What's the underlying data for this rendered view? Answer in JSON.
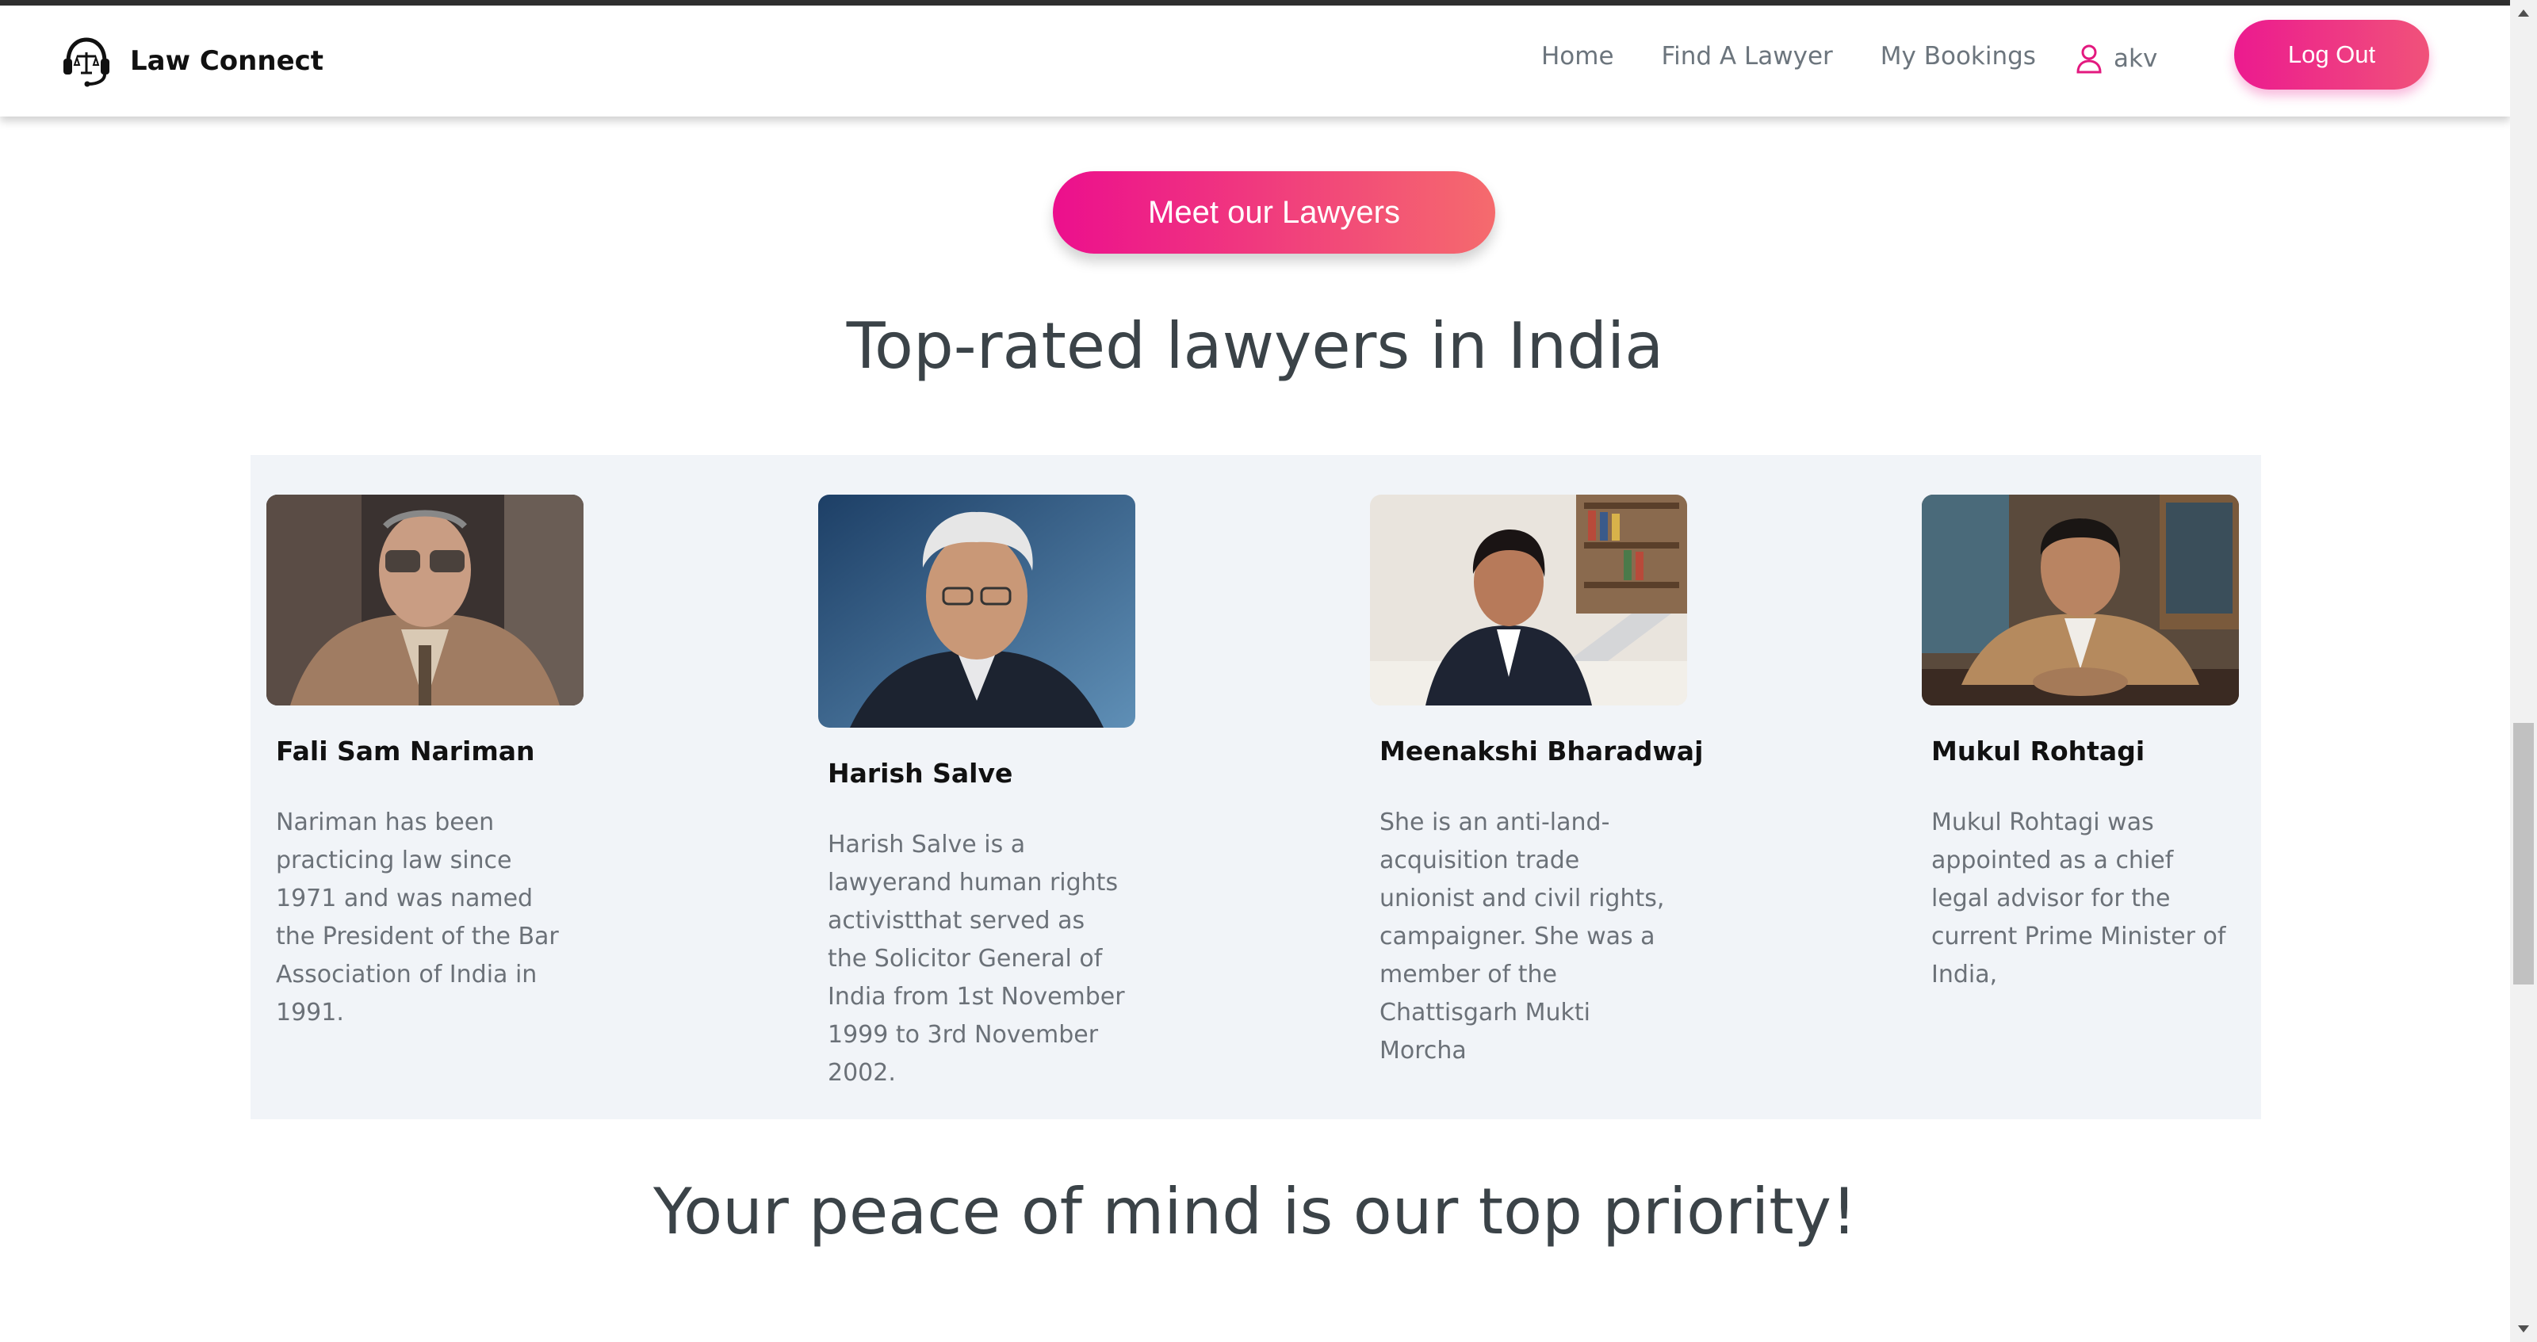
{
  "nav": {
    "brand": "Law Connect",
    "brand_icon": "support-headset-scales-icon",
    "links": [
      "Home",
      "Find A Lawyer",
      "My Bookings"
    ],
    "user_icon": "user-icon",
    "user_name": "akv",
    "logout_label": "Log Out"
  },
  "hero": {
    "meet_button": "Meet our Lawyers",
    "title": "Top-rated lawyers in India"
  },
  "lawyers": [
    {
      "name": "Fali Sam Nariman",
      "description": "Nariman has been practicing law since 1971 and was named the President of the Bar Association of India in 1991."
    },
    {
      "name": "Harish Salve",
      "description": "Harish Salve is a lawyerand human rights activistthat served as the Solicitor General of India from 1st November 1999 to 3rd November 2002."
    },
    {
      "name": "Meenakshi Bharadwaj",
      "description": "She is an anti-land-acquisition trade unionist and civil rights, campaigner. She was a member of the Chattisgarh Mukti Morcha"
    },
    {
      "name": "Mukul Rohtagi",
      "description": "Mukul Rohtagi was appointed as a chief legal advisor for the current Prime Minister of India,"
    }
  ],
  "footer_section": {
    "title": "Your peace of mind is our top priority!"
  },
  "colors": {
    "accent_start": "#ec1a8f",
    "accent_end": "#f56b6d",
    "panel_bg": "#f1f4f8",
    "heading": "#3b4348"
  }
}
